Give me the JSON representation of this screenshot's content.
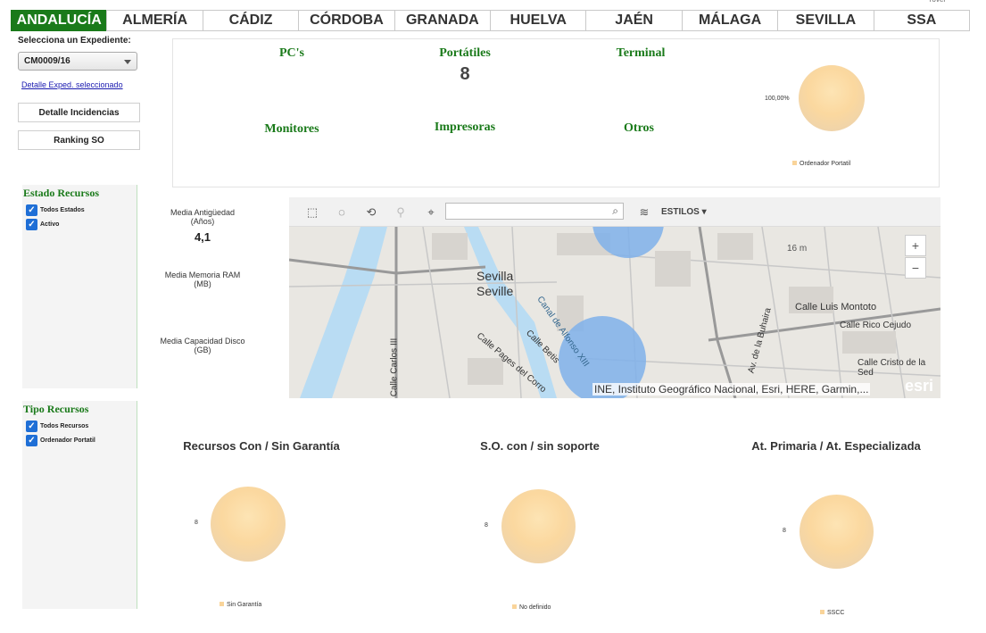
{
  "tabs": [
    "ANDALUCÍA",
    "ALMERÍA",
    "CÁDIZ",
    "CÓRDOBA",
    "GRANADA",
    "HUELVA",
    "JAÉN",
    "MÁLAGA",
    "SEVILLA",
    "SSA"
  ],
  "corner_text": "rover",
  "sidebar": {
    "select_label": "Selecciona un Expediente:",
    "select_value": "CM0009/16",
    "detail_link": "Detalle Exped. seleccionado",
    "btn_incidencias": "Detalle Incidencias",
    "btn_ranking": "Ranking SO",
    "estado": {
      "title": "Estado Recursos",
      "items": [
        "Todos Estados",
        "Activo"
      ]
    },
    "tipo": {
      "title": "Tipo Recursos",
      "items": [
        "Todos Recursos",
        "Ordenador Portatil"
      ]
    }
  },
  "summary": {
    "pcs": "PC's",
    "portatiles": "Portátiles",
    "portatiles_value": "8",
    "terminal": "Terminal",
    "monitores": "Monitores",
    "impresoras": "Impresoras",
    "otros": "Otros",
    "pie_percent": "100,00%",
    "pie_legend": "Ordenador Portatil"
  },
  "media": {
    "antiguedad_label1": "Media Antigüedad",
    "antiguedad_label2": "(Años)",
    "antiguedad_value": "4,1",
    "memoria_label1": "Media Memoria RAM",
    "memoria_label2": "(MB)",
    "disco_label1": "Media Capacidad Disco",
    "disco_label2": "(GB)"
  },
  "map": {
    "estilos": "ESTILOS",
    "city": "Sevilla",
    "city2": "Seville",
    "streets": [
      "Calle Luis Montoto",
      "Calle Rico Cejudo",
      "Calle Cristo de la Sed",
      "Calle Betis",
      "Calle Pages del Corro",
      "Canal de Alfonso XIII",
      "Calle Carlos III",
      "Av. de la Buhaira"
    ],
    "elevation": "16 m",
    "attribution": "INE, Instituto Geográfico Nacional, Esri, HERE, Garmin,...",
    "logo": "esri",
    "zoom_in": "+",
    "zoom_out": "−"
  },
  "charts": [
    {
      "title": "Recursos Con / Sin Garantía",
      "value": "8",
      "legend": "Sin Garantía"
    },
    {
      "title": "S.O. con / sin soporte",
      "value": "8",
      "legend": "No definido"
    },
    {
      "title": "At. Primaria / At. Especializada",
      "value": "8",
      "legend": "SSCC"
    }
  ],
  "colors": {
    "accent": "#1a7a1a",
    "pie": "#fbd89f",
    "map_circle": "#7fb0ea"
  }
}
